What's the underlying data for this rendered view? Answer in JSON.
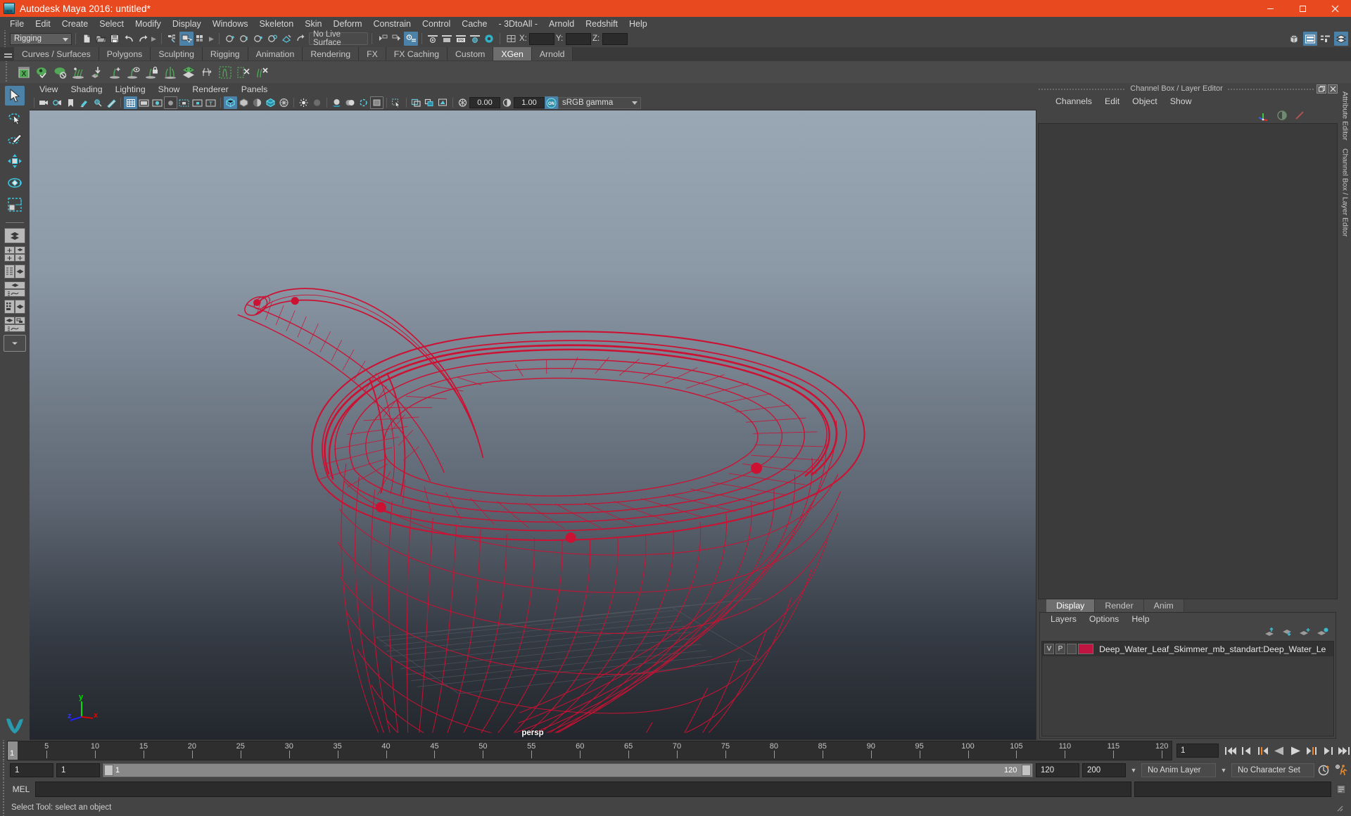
{
  "titlebar": {
    "title": "Autodesk Maya 2016: untitled*",
    "icon": "maya-logo-icon",
    "minimize": "–",
    "maximize": "□",
    "close": "✕"
  },
  "menubar": {
    "items": [
      {
        "label": "File"
      },
      {
        "label": "Edit"
      },
      {
        "label": "Create"
      },
      {
        "label": "Select"
      },
      {
        "label": "Modify"
      },
      {
        "label": "Display"
      },
      {
        "label": "Windows"
      },
      {
        "label": "Skeleton"
      },
      {
        "label": "Skin"
      },
      {
        "label": "Deform"
      },
      {
        "label": "Constrain"
      },
      {
        "label": "Control"
      },
      {
        "label": "Cache"
      },
      {
        "label": "- 3DtoAll -"
      },
      {
        "label": "Arnold"
      },
      {
        "label": "Redshift"
      },
      {
        "label": "Help"
      }
    ]
  },
  "statusline": {
    "menu_set": "Rigging",
    "live_surface": "No Live Surface",
    "coords": [
      {
        "label": "X:",
        "value": ""
      },
      {
        "label": "Y:",
        "value": ""
      },
      {
        "label": "Z:",
        "value": ""
      }
    ]
  },
  "shelf": {
    "tabs": [
      {
        "label": "Curves / Surfaces",
        "active": false
      },
      {
        "label": "Polygons",
        "active": false
      },
      {
        "label": "Sculpting",
        "active": false
      },
      {
        "label": "Rigging",
        "active": false
      },
      {
        "label": "Animation",
        "active": false
      },
      {
        "label": "Rendering",
        "active": false
      },
      {
        "label": "FX",
        "active": false
      },
      {
        "label": "FX Caching",
        "active": false
      },
      {
        "label": "Custom",
        "active": false
      },
      {
        "label": "XGen",
        "active": true
      },
      {
        "label": "Arnold",
        "active": false
      }
    ],
    "icons": [
      "xgen-window-icon",
      "xgen-preview-icon",
      "xgen-disable-preview-icon",
      "xgen-add-density-icon",
      "xgen-baked-groom-icon",
      "xgen-add-guide-icon",
      "xgen-guide-eye-icon",
      "xgen-lock-guide-icon",
      "xgen-mirror-guide-icon",
      "xgen-density-map-icon",
      "xgen-width-icon",
      "xgen-select-region-icon",
      "xgen-clear-icon"
    ]
  },
  "toolbox": {
    "tools": [
      {
        "name": "select-tool",
        "selected": true
      },
      {
        "name": "lasso-select-tool",
        "selected": false
      },
      {
        "name": "paint-select-tool",
        "selected": false
      },
      {
        "name": "move-tool",
        "selected": false
      },
      {
        "name": "rotate-tool",
        "selected": false
      },
      {
        "name": "scale-tool",
        "selected": false
      }
    ],
    "layouts": [
      "single-perspective-layout",
      "four-view-layout",
      "outliner-persp-layout",
      "persp-graph-layout",
      "hypershade-persp-layout",
      "persp-graph-outliner-layout",
      "more-layouts"
    ]
  },
  "viewport": {
    "menus": [
      {
        "label": "View"
      },
      {
        "label": "Shading"
      },
      {
        "label": "Lighting"
      },
      {
        "label": "Show"
      },
      {
        "label": "Renderer"
      },
      {
        "label": "Panels"
      }
    ],
    "exposure": "0.00",
    "gamma_value": "1.00",
    "color_management": "sRGB gamma",
    "camera_label": "persp",
    "axis": {
      "x": "x",
      "y": "y",
      "z": "z"
    },
    "model": {
      "name": "Deep Water Leaf Skimmer wireframe",
      "wireframe_color": "#cc1133"
    }
  },
  "channelbox": {
    "panel_title": "Channel Box / Layer Editor",
    "menus": [
      {
        "label": "Channels"
      },
      {
        "label": "Edit"
      },
      {
        "label": "Object"
      },
      {
        "label": "Show"
      }
    ],
    "icons": [
      "channel-box-icon",
      "attribute-editor-icon",
      "layer-editor-icon"
    ]
  },
  "layer_editor": {
    "tabs": [
      {
        "label": "Display",
        "active": true
      },
      {
        "label": "Render",
        "active": false
      },
      {
        "label": "Anim",
        "active": false
      }
    ],
    "menus": [
      {
        "label": "Layers"
      },
      {
        "label": "Options"
      },
      {
        "label": "Help"
      }
    ],
    "toolbar_icons": [
      "move-layer-up-icon",
      "move-layer-down-icon",
      "new-layer-icon",
      "new-layer-from-selected-icon"
    ],
    "layers": [
      {
        "visibility": "V",
        "playback": "P",
        "type": "",
        "color": "#c01540",
        "name": "Deep_Water_Leaf_Skimmer_mb_standart:Deep_Water_Le"
      }
    ]
  },
  "right_tabs": [
    {
      "label": "Attribute Editor"
    },
    {
      "label": "Channel Box / Layer Editor"
    }
  ],
  "timeline": {
    "start": 1,
    "end": 120,
    "current_frame": "1",
    "ticks": [
      5,
      10,
      15,
      20,
      25,
      30,
      35,
      40,
      45,
      50,
      55,
      60,
      65,
      70,
      75,
      80,
      85,
      90,
      95,
      100,
      105,
      110,
      115,
      120
    ],
    "cursor_label": "1",
    "playback_buttons": [
      "go-to-start-icon",
      "step-back-keyframe-icon",
      "step-back-frame-icon",
      "play-backwards-icon",
      "play-forwards-icon",
      "step-forward-frame-icon",
      "step-forward-keyframe-icon",
      "go-to-end-icon"
    ]
  },
  "range_slider": {
    "anim_start": "1",
    "range_start": "1",
    "range_bar_label": "1",
    "range_bar_end_label": "120",
    "range_end": "120",
    "anim_end": "200",
    "anim_layer": "No Anim Layer",
    "character_set": "No Character Set",
    "buttons": [
      "auto-keyframe-icon",
      "animation-preferences-icon"
    ]
  },
  "command_line": {
    "language": "MEL",
    "input_value": "",
    "output_value": ""
  },
  "help_line": {
    "text": "Select Tool: select an object"
  },
  "colors": {
    "title_bar": "#e8491f",
    "app_background": "#444444",
    "accent_blue": "#4c82a8",
    "shelf_green": "#53a857",
    "wireframe_red": "#cc1133",
    "viewport_top": "#9aa7b4",
    "viewport_bottom": "#23272d"
  }
}
